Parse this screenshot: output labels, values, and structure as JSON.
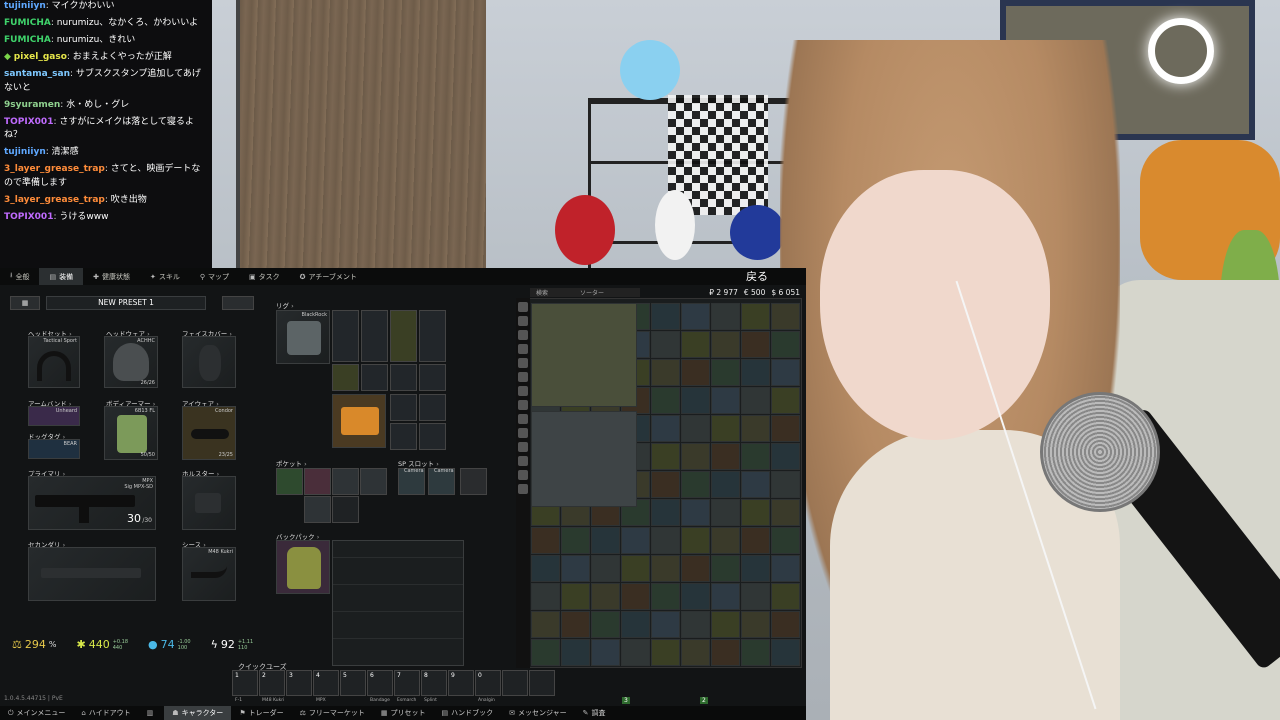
{
  "chat": {
    "messages": [
      {
        "user": "tujiniiyn",
        "text": "マイクかわいい",
        "color": "#5fa8ff"
      },
      {
        "user": "FUMICHA",
        "text": "nurumizu、なかくろ、かわいいよ",
        "color": "#3fd36b"
      },
      {
        "user": "FUMICHA",
        "text": "nurumizu、きれい",
        "color": "#3fd36b"
      },
      {
        "user": "pixel_gaso",
        "text": "おまえよくやったが正解",
        "color": "#e6e64a",
        "badge": "◆"
      },
      {
        "user": "santama_san",
        "text": "サブスクスタンプ追加してあげないと",
        "color": "#7ec8ff"
      },
      {
        "user": "9syuramen",
        "text": "水・めし・グレ",
        "color": "#8fd18f"
      },
      {
        "user": "TOPIX001",
        "text": "さすがにメイクは落として寝るよね？",
        "color": "#c06bff"
      },
      {
        "user": "tujiniiyn",
        "text": "清潔感",
        "color": "#5fa8ff"
      },
      {
        "user": "3_layer_grease_trap",
        "text": "さてと、映画デートなので準備します",
        "color": "#ff8c3a"
      },
      {
        "user": "3_layer_grease_trap",
        "text": "吹き出物",
        "color": "#ff8c3a"
      },
      {
        "user": "TOPIX001",
        "text": "うけるwww",
        "color": "#c06bff"
      }
    ]
  },
  "game": {
    "topnav": [
      {
        "label": "全般",
        "icon": "download-icon"
      },
      {
        "label": "装備",
        "icon": "gear-icon",
        "active": true
      },
      {
        "label": "健康状態",
        "icon": "health-icon"
      },
      {
        "label": "スキル",
        "icon": "skill-icon"
      },
      {
        "label": "マップ",
        "icon": "map-pin-icon"
      },
      {
        "label": "タスク",
        "icon": "task-icon"
      },
      {
        "label": "アチーブメント",
        "icon": "achievement-icon"
      }
    ],
    "back_label": "戻る",
    "money": {
      "rub": "₽ 2 977",
      "eur": "€ 500",
      "usd": "$ 6 051"
    },
    "preset_name": "NEW PRESET 1",
    "equipment": {
      "headset_label": "ヘッドセット",
      "headset_item": "Tactical Sport",
      "headwear_label": "ヘッドウェア",
      "headwear_item": "ACHHC",
      "headwear_dur": "26/26",
      "facecover_label": "フェイスカバー",
      "armband_label": "アームバンド",
      "armband_item": "Unheard",
      "bodyarmor_label": "ボディアーマー",
      "bodyarmor_item": "6B13 FL",
      "bodyarmor_dur": "50/50",
      "eyewear_label": "アイウェア",
      "eyewear_item": "Condor",
      "eyewear_dur": "23/25",
      "dogtag_label": "ドッグタグ",
      "dogtag_item": "BEAR",
      "primary_label": "プライマリ",
      "primary_item": "MPX",
      "primary_sub": "Sig MPX-SD",
      "primary_ammo": "30",
      "primary_ammo_sub": "/30",
      "holster_label": "ホルスター",
      "secondary_label": "セカンダリ",
      "sheath_label": "シース",
      "sheath_item": "M48 Kukri",
      "rig_label": "リグ",
      "rig_item": "BlackRock",
      "pockets_label": "ポケット",
      "sp_slot_label": "SP スロット",
      "backpack_label": "バックパック",
      "camera1": "Camera",
      "camera2": "Camera"
    },
    "stats": [
      {
        "icon": "weight-icon",
        "value": "294",
        "unit": "%",
        "sub": "",
        "color": "#e6c84a"
      },
      {
        "icon": "energy-icon",
        "value": "440",
        "sub1": "+0.18",
        "sub2": "440",
        "color": "#d8e84a"
      },
      {
        "icon": "water-icon",
        "value": "74",
        "sub1": "-1.00",
        "sub2": "100",
        "color": "#4ab8e6"
      },
      {
        "icon": "bolt-icon",
        "value": "92",
        "sub1": "+1.11",
        "sub2": "110",
        "color": "#ffffff"
      }
    ],
    "stash_search_placeholder": "検索",
    "stash_sorter": "ソーター",
    "quickbar_label": "クイックユーズ",
    "quickslots": [
      {
        "n": "1",
        "item": "F-1"
      },
      {
        "n": "2",
        "item": "M48 Kukri"
      },
      {
        "n": "3",
        "item": ""
      },
      {
        "n": "4",
        "item": "MPX"
      },
      {
        "n": "5",
        "item": ""
      },
      {
        "n": "6",
        "item": "Bandage"
      },
      {
        "n": "7",
        "item": "Esmarch"
      },
      {
        "n": "8",
        "item": "Splint"
      },
      {
        "n": "9",
        "item": ""
      },
      {
        "n": "0",
        "item": "Analgin"
      },
      {
        "n": "",
        "item": ""
      },
      {
        "n": "",
        "item": ""
      }
    ],
    "version": "1.0.4.5.44715 | PvE",
    "bottombar": [
      {
        "label": "メインメニュー",
        "icon": "menu-icon"
      },
      {
        "label": "ハイドアウト",
        "icon": "hideout-icon"
      },
      {
        "label": "",
        "icon": "stash-icon"
      },
      {
        "label": "キャラクター",
        "icon": "character-icon",
        "active": true
      },
      {
        "label": "トレーダー",
        "icon": "trader-icon"
      },
      {
        "label": "フリーマーケット",
        "icon": "market-icon"
      },
      {
        "label": "プリセット",
        "icon": "preset-icon"
      },
      {
        "label": "ハンドブック",
        "icon": "handbook-icon"
      },
      {
        "label": "メッセンジャー",
        "icon": "messenger-icon"
      },
      {
        "label": "調査",
        "icon": "survey-icon"
      }
    ],
    "badges": {
      "b1": "3",
      "b2": "2"
    }
  }
}
